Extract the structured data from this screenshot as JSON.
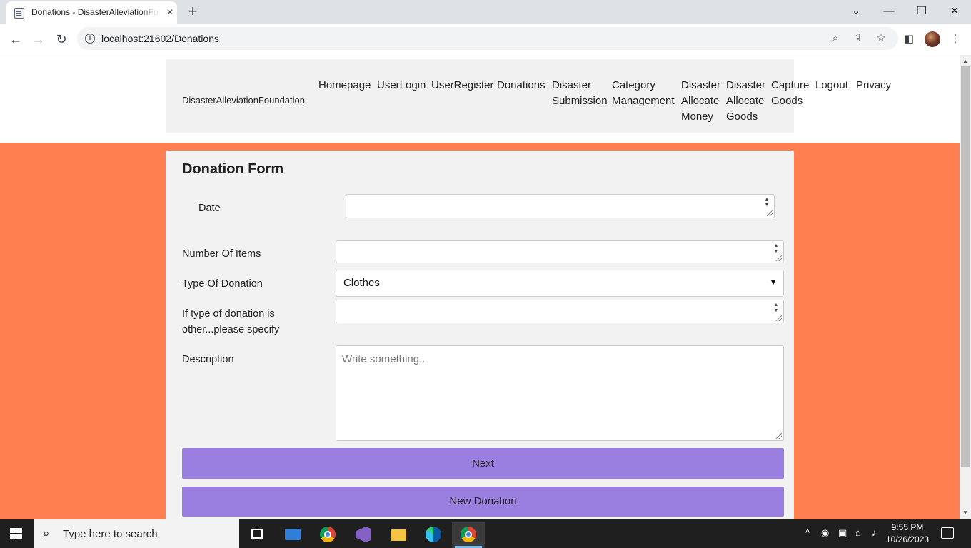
{
  "browser": {
    "tab_title": "Donations - DisasterAlleviationFoundation",
    "url": "localhost:21602/Donations",
    "new_tab_label": "+",
    "window_controls": {
      "dropdown": "⌄",
      "minimize": "—",
      "restore": "❐",
      "close": "✕"
    }
  },
  "site": {
    "brand": "DisasterAlleviationFoundation",
    "nav": [
      {
        "lines": [
          "Homepage"
        ]
      },
      {
        "lines": [
          "UserLogin"
        ]
      },
      {
        "lines": [
          "UserRegister"
        ]
      },
      {
        "lines": [
          "Donations"
        ]
      },
      {
        "lines": [
          "Disaster",
          "Submission"
        ]
      },
      {
        "lines": [
          "Category",
          "Management"
        ]
      },
      {
        "lines": [
          "Disaster",
          "Allocate",
          "Money"
        ]
      },
      {
        "lines": [
          "Disaster",
          "Allocate",
          "Goods"
        ]
      },
      {
        "lines": [
          "Capture",
          "Goods"
        ]
      },
      {
        "lines": [
          "Logout"
        ]
      },
      {
        "lines": [
          "Privacy"
        ]
      }
    ]
  },
  "form": {
    "title": "Donation Form",
    "date_label": "Date",
    "date_value": "",
    "items_label": "Number Of Items",
    "items_value": "",
    "type_label": "Type Of Donation",
    "type_value": "Clothes",
    "other_label_line1": "If type of donation is",
    "other_label_line2": "other...please specify",
    "other_value": "",
    "description_label": "Description",
    "description_placeholder": "Write something..",
    "next_button": "Next",
    "new_donation_button": "New Donation"
  },
  "taskbar": {
    "search_placeholder": "Type here to search",
    "time": "9:55 PM",
    "date": "10/26/2023"
  },
  "colors": {
    "page_background": "#ff7f50",
    "card_background": "#f2f2f2",
    "button": "#9b7fe0"
  }
}
